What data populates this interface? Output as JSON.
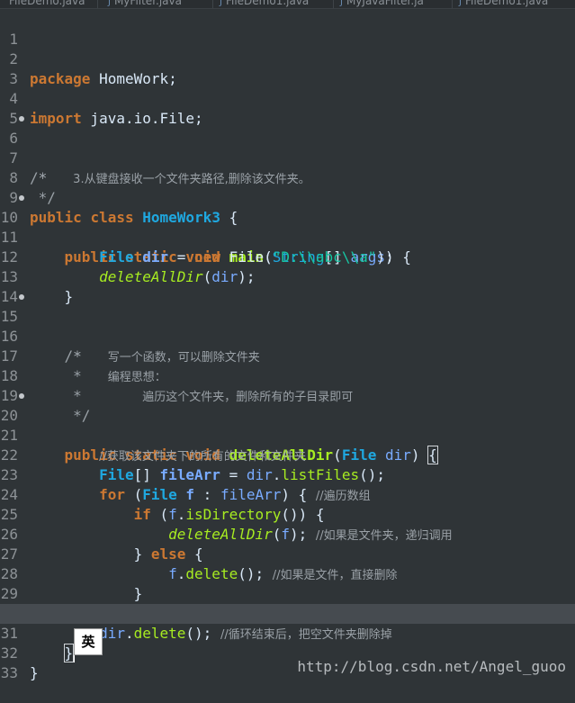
{
  "tabs": [
    {
      "label": "FileDemo.java"
    },
    {
      "label": "MyFilter.java"
    },
    {
      "label": "FileDemo1.java"
    },
    {
      "label": "MyJavaFilter.ja"
    },
    {
      "label": "FileDemo1.java"
    }
  ],
  "code": {
    "lines": [
      {
        "n": "1"
      },
      {
        "n": "2",
        "package_kw": "package",
        "package_name": " HomeWork;"
      },
      {
        "n": "3"
      },
      {
        "n": "4",
        "import_kw": "import",
        "import_name": " java.io.File;"
      },
      {
        "n": "5"
      },
      {
        "n": "6",
        "text": "/*"
      },
      {
        "n": "7",
        "prefix": " *   ",
        "text": "3.从键盘接收一个文件夹路径,删除该文件夹。"
      },
      {
        "n": "8",
        "text": " */"
      },
      {
        "n": "9",
        "kw1": "public",
        "kw2": "class",
        "name": "HomeWork3",
        "tail": " {"
      },
      {
        "n": "10",
        "kw1": "public",
        "kw2": "static",
        "kw3": "void",
        "method": "main",
        "p1": "(",
        "ptype": "String",
        "p2": "[] ",
        "pname": "args",
        "tail": ") {"
      },
      {
        "n": "11",
        "type": "File",
        "var": "dir",
        "eq": " = ",
        "kw": "new",
        "ctor": " File(",
        "str": "\"D:\\\\abc\\\\a\"",
        "tail": ");"
      },
      {
        "n": "12",
        "call": "deleteAllDir",
        "p1": "(",
        "arg": "dir",
        "tail": ");"
      },
      {
        "n": "13",
        "text": "}"
      },
      {
        "n": "14"
      },
      {
        "n": "15",
        "text": "/*"
      },
      {
        "n": "16",
        "prefix": " *   ",
        "text": "写一个函数，可以删除文件夹"
      },
      {
        "n": "17",
        "prefix": " *   ",
        "text": "编程思想："
      },
      {
        "n": "18",
        "prefix": " *       ",
        "text": "遍历这个文件夹，删除所有的子目录即可"
      },
      {
        "n": "19",
        "text": " */"
      },
      {
        "n": "20",
        "kw1": "public",
        "kw2": "static",
        "kw3": "void",
        "method": "deleteAllDir",
        "p1": "(",
        "ptype": "File",
        "pname": "dir",
        "tail": ") ",
        "brace": "{"
      },
      {
        "n": "21",
        "text": "//获取该文件夹下的所有的文件和文件夹"
      },
      {
        "n": "22",
        "type": "File",
        "t2": "[] ",
        "var": "fileArr",
        "eq": " = ",
        "obj": "dir",
        "dot": ".",
        "call": "listFiles",
        "tail": "();"
      },
      {
        "n": "23",
        "kw": "for",
        "p1": " (",
        "type": "File",
        "var": "f",
        "colon": " : ",
        "var2": "fileArr",
        "tail": ") { ",
        "comment": "//遍历数组"
      },
      {
        "n": "24",
        "kw": "if",
        "p1": " (",
        "obj": "f",
        "dot": ".",
        "call": "isDirectory",
        "tail": "()) {"
      },
      {
        "n": "25",
        "call": "deleteAllDir",
        "p1": "(",
        "arg": "f",
        "tail": "); ",
        "comment": "//如果是文件夹，递归调用"
      },
      {
        "n": "26",
        "pre": "} ",
        "kw": "else",
        "tail": " {"
      },
      {
        "n": "27",
        "obj": "f",
        "dot": ".",
        "call": "delete",
        "tail": "(); ",
        "comment": "//如果是文件，直接删除"
      },
      {
        "n": "28",
        "text": "}"
      },
      {
        "n": "29",
        "text": "}"
      },
      {
        "n": "30",
        "obj": "dir",
        "dot": ".",
        "call": "delete",
        "tail": "(); ",
        "comment": "//循环结束后，把空文件夹删除掉"
      },
      {
        "n": "31",
        "text": "}"
      },
      {
        "n": "32",
        "text": "}"
      },
      {
        "n": "33"
      }
    ]
  },
  "ime_indicator": "英",
  "watermark": "http://blog.csdn.net/Angel_guoo",
  "colors": {
    "background": "#2f3437",
    "keyword": "#cc7832",
    "class_name": "#1fa8e0",
    "method": "#a7ec21",
    "variable": "#79abff",
    "string": "#17c6a3",
    "comment": "#9aa1a7"
  }
}
